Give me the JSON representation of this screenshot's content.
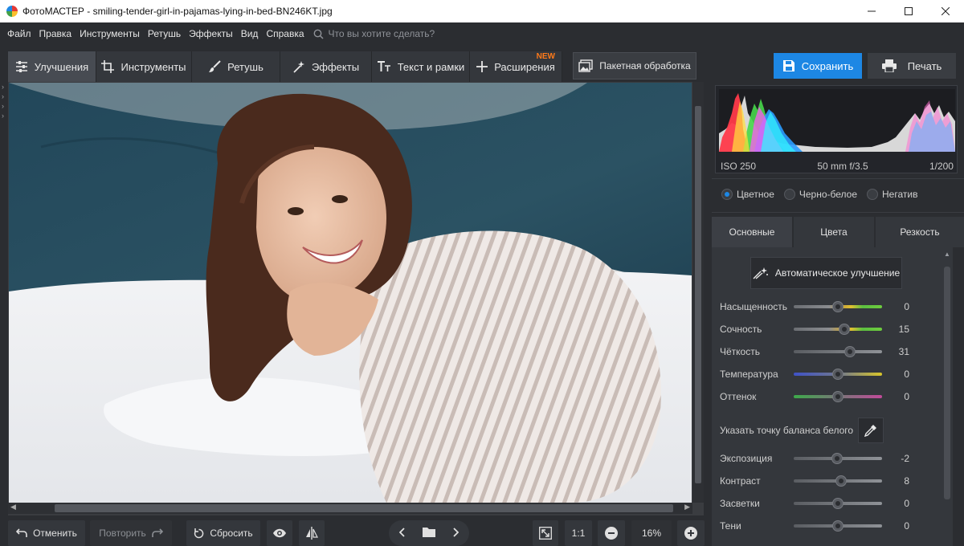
{
  "app": {
    "title": "ФотоМАСТЕР - smiling-tender-girl-in-pajamas-lying-in-bed-BN246KT.jpg"
  },
  "menu": {
    "items": [
      "Файл",
      "Правка",
      "Инструменты",
      "Ретушь",
      "Эффекты",
      "Вид",
      "Справка"
    ],
    "search_placeholder": "Что вы хотите сделать?"
  },
  "toolbar": {
    "tabs": [
      {
        "label": "Улучшения",
        "icon": "sliders-icon",
        "active": true
      },
      {
        "label": "Инструменты",
        "icon": "crop-icon"
      },
      {
        "label": "Ретушь",
        "icon": "brush-icon"
      },
      {
        "label": "Эффекты",
        "icon": "magic-wand-icon"
      },
      {
        "label": "Текст и рамки",
        "icon": "text-icon"
      },
      {
        "label": "Расширения",
        "icon": "plus-icon",
        "badge": "NEW"
      }
    ],
    "batch_label": "Пакетная обработка",
    "save_label": "Сохранить",
    "print_label": "Печать"
  },
  "colors": {
    "accent": "#1d87e4",
    "badge": "#ff7a1a",
    "background": "#2b2d31"
  },
  "histogram": {
    "iso": "ISO 250",
    "lens": "50 mm f/3.5",
    "shutter": "1/200"
  },
  "modes": {
    "options": [
      "Цветное",
      "Черно-белое",
      "Негатив"
    ],
    "selected": "Цветное"
  },
  "panel_tabs": {
    "items": [
      "Основные",
      "Цвета",
      "Резкость"
    ],
    "active": "Основные"
  },
  "auto_enhance_label": "Автоматическое улучшение",
  "white_balance_label": "Указать точку баланса белого",
  "sliders": [
    {
      "label": "Насыщенность",
      "value": "0",
      "position": 0.5,
      "gradient": "sat"
    },
    {
      "label": "Сочность",
      "value": "15",
      "position": 0.57,
      "gradient": "sat"
    },
    {
      "label": "Чёткость",
      "value": "31",
      "position": 0.64,
      "gradient": "gray"
    },
    {
      "label": "Температура",
      "value": "0",
      "position": 0.5,
      "gradient": "temp"
    },
    {
      "label": "Оттенок",
      "value": "0",
      "position": 0.5,
      "gradient": "tint"
    },
    {
      "label": "Экспозиция",
      "value": "-2",
      "position": 0.49,
      "gradient": "gray"
    },
    {
      "label": "Контраст",
      "value": "8",
      "position": 0.54,
      "gradient": "gray"
    },
    {
      "label": "Засветки",
      "value": "0",
      "position": 0.5,
      "gradient": "gray"
    },
    {
      "label": "Тени",
      "value": "0",
      "position": 0.5,
      "gradient": "gray"
    }
  ],
  "bottom": {
    "undo_label": "Отменить",
    "redo_label": "Повторить",
    "reset_label": "Сбросить",
    "ratio_label": "1:1",
    "zoom": "16%"
  }
}
